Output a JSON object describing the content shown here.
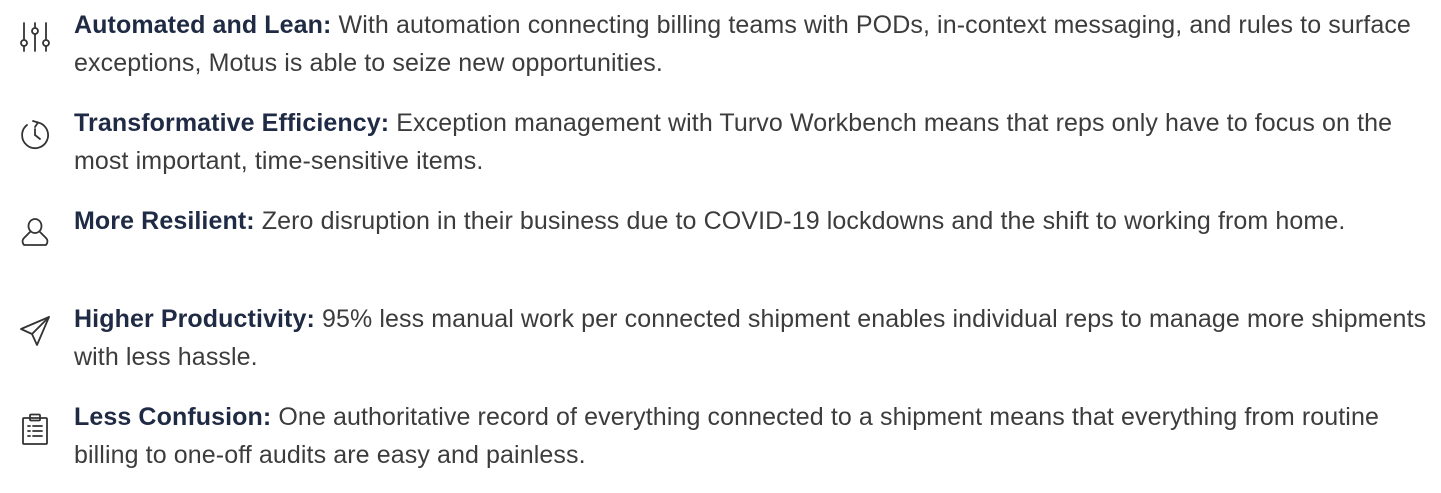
{
  "benefits": [
    {
      "icon": "sliders-icon",
      "title": "Automated and Lean:",
      "text": "With automation connecting billing teams with PODs, in-context messaging, and rules to surface exceptions, Motus is able to seize new opportunities."
    },
    {
      "icon": "clock-refresh-icon",
      "title": "Transformative Efficiency:",
      "text": "Exception management with Turvo Workbench means that reps only have to focus on the most important, time-sensitive items."
    },
    {
      "icon": "user-icon",
      "title": "More Resilient:",
      "text": "Zero disruption in their business due to COVID-19 lockdowns and the shift to working from home."
    },
    {
      "icon": "paper-plane-icon",
      "title": "Higher Productivity:",
      "text": "95% less manual work per connected shipment enables individual reps to manage more shipments with less hassle."
    },
    {
      "icon": "clipboard-list-icon",
      "title": "Less Confusion:",
      "text": "One authoritative record of everything connected to a shipment means that everything from routine billing to one-off audits are easy and painless."
    }
  ],
  "colors": {
    "title": "#1f2a44",
    "body_text": "#3c3c3c",
    "icon_stroke": "#333333",
    "background": "#ffffff"
  }
}
